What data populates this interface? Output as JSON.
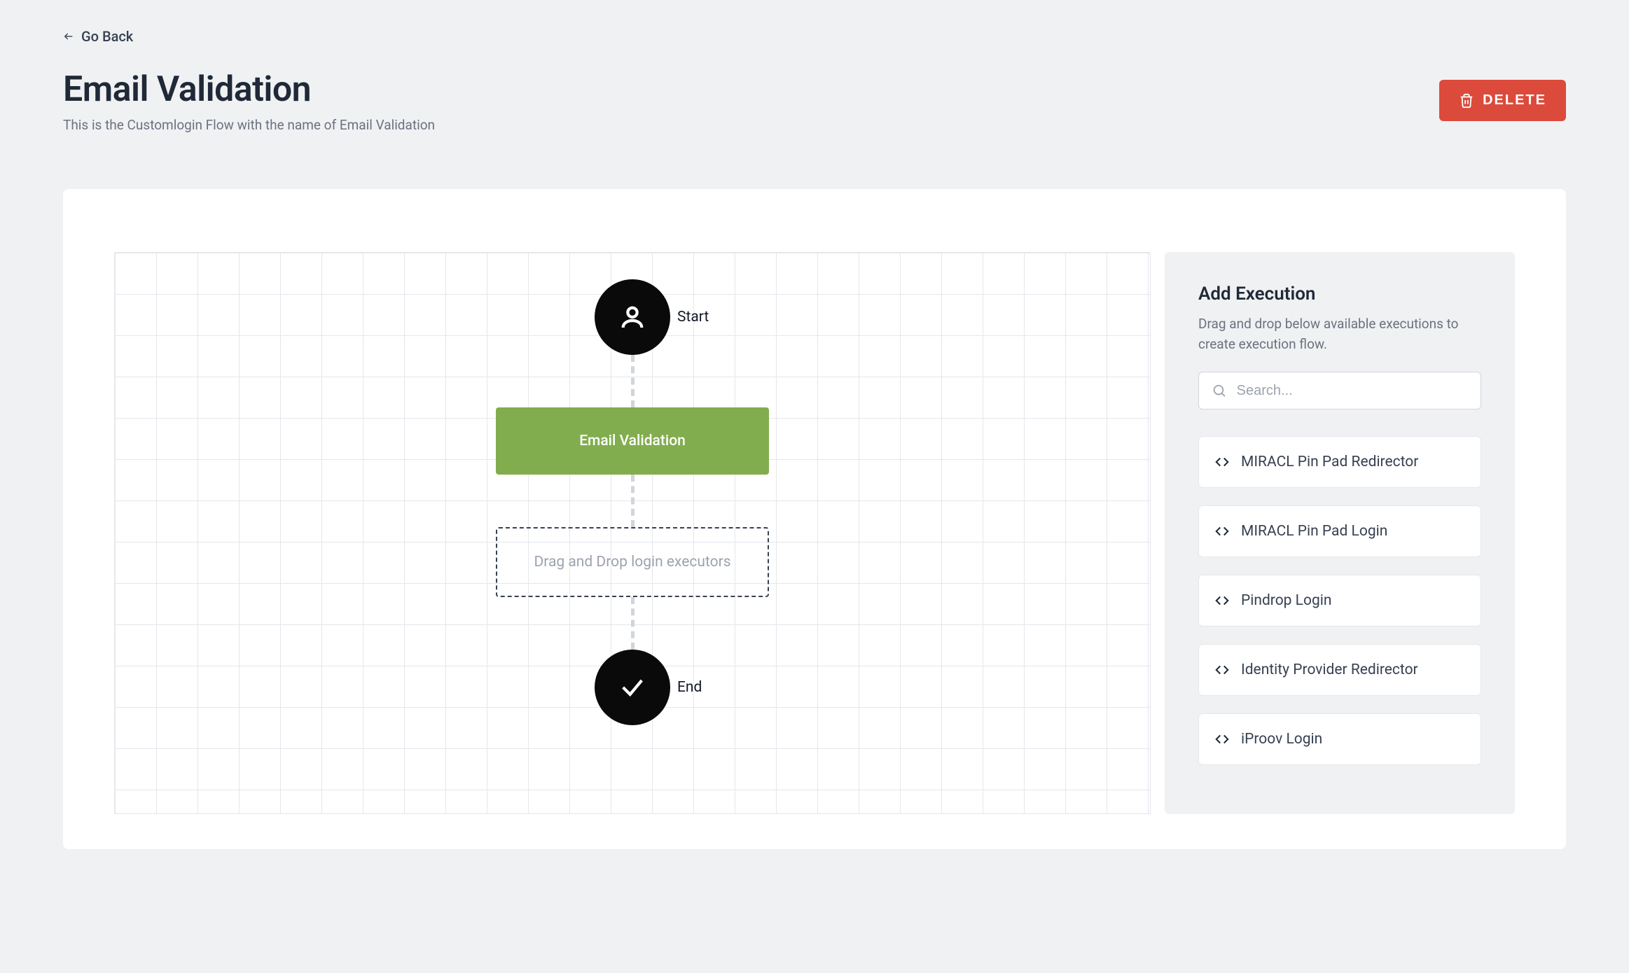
{
  "nav": {
    "go_back": "Go Back"
  },
  "header": {
    "title": "Email Validation",
    "subtitle": "This is the Customlogin Flow with the name of Email Validation",
    "delete_label": "DELETE"
  },
  "flow": {
    "start_label": "Start",
    "end_label": "End",
    "block_label": "Email Validation",
    "drop_hint": "Drag and Drop login executors"
  },
  "sidebar": {
    "title": "Add Execution",
    "description": "Drag and drop below available executions to create execution flow.",
    "search_placeholder": "Search...",
    "executions": [
      {
        "label": "MIRACL Pin Pad Redirector"
      },
      {
        "label": "MIRACL Pin Pad Login"
      },
      {
        "label": "Pindrop Login"
      },
      {
        "label": "Identity Provider Redirector"
      },
      {
        "label": "iProov Login"
      }
    ]
  }
}
